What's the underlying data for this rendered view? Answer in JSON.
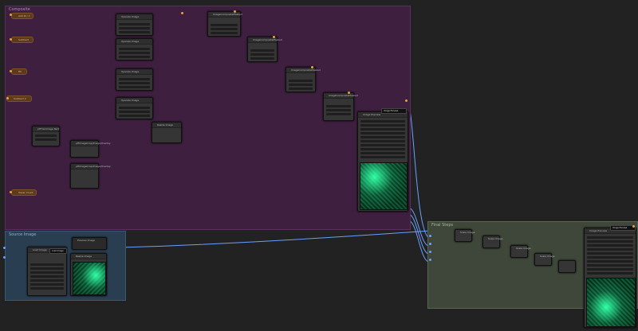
{
  "groups": {
    "composite": {
      "title": "Composite",
      "color": "#3e1f3f",
      "title_color": "#b48cc0"
    },
    "source_image": {
      "title": "Source Image",
      "color": "#2a3e52",
      "title_color": "#8fb2d0"
    },
    "final_steps": {
      "title": "Final Steps",
      "color": "#3e4739",
      "title_color": "#a9b99c"
    }
  },
  "inputs": [
    {
      "label": "Add W / 2"
    },
    {
      "label": "Subtract"
    },
    {
      "label": "Fill"
    },
    {
      "label": "Subtract 2"
    },
    {
      "label": "Tower Count"
    }
  ],
  "node_titles": {
    "upscale_1": "Upscale Image",
    "upscale_2": "Upscale Image",
    "upscale_3": "Upscale Image",
    "upscale_4": "Upscale Image",
    "composite_1": "ImageCompositeMasked",
    "composite_2": "ImageCompositeMasked",
    "composite_3": "ImageCompositeMasked",
    "composite_4": "ImageCompositeMasked",
    "crop_1": "pHImageCrop/Image/Overlay",
    "crop_2": "pHImageCrop/Image/Overlay",
    "tile_node": "pHTile Image Rect",
    "preview_composite": "Image Preview",
    "preview_final": "Image Preview",
    "load_image": "Load Image",
    "resize": "Resize Image",
    "preview_image": "Preview Image",
    "final_scale_1": "Scale Image",
    "final_scale_2": "Scale Image",
    "final_scale_3": "Scale Image",
    "final_scale_4": "Scale Image"
  },
  "badges": {
    "composite_out": "Image Preview",
    "final_out": "Image Preview",
    "source_out": "Load Image"
  },
  "colors": {
    "accent_orange": "#e8a33d",
    "link_blue": "#6aa0ff",
    "link_gray": "#aaaaaa",
    "link_green": "#6ccf7a"
  }
}
